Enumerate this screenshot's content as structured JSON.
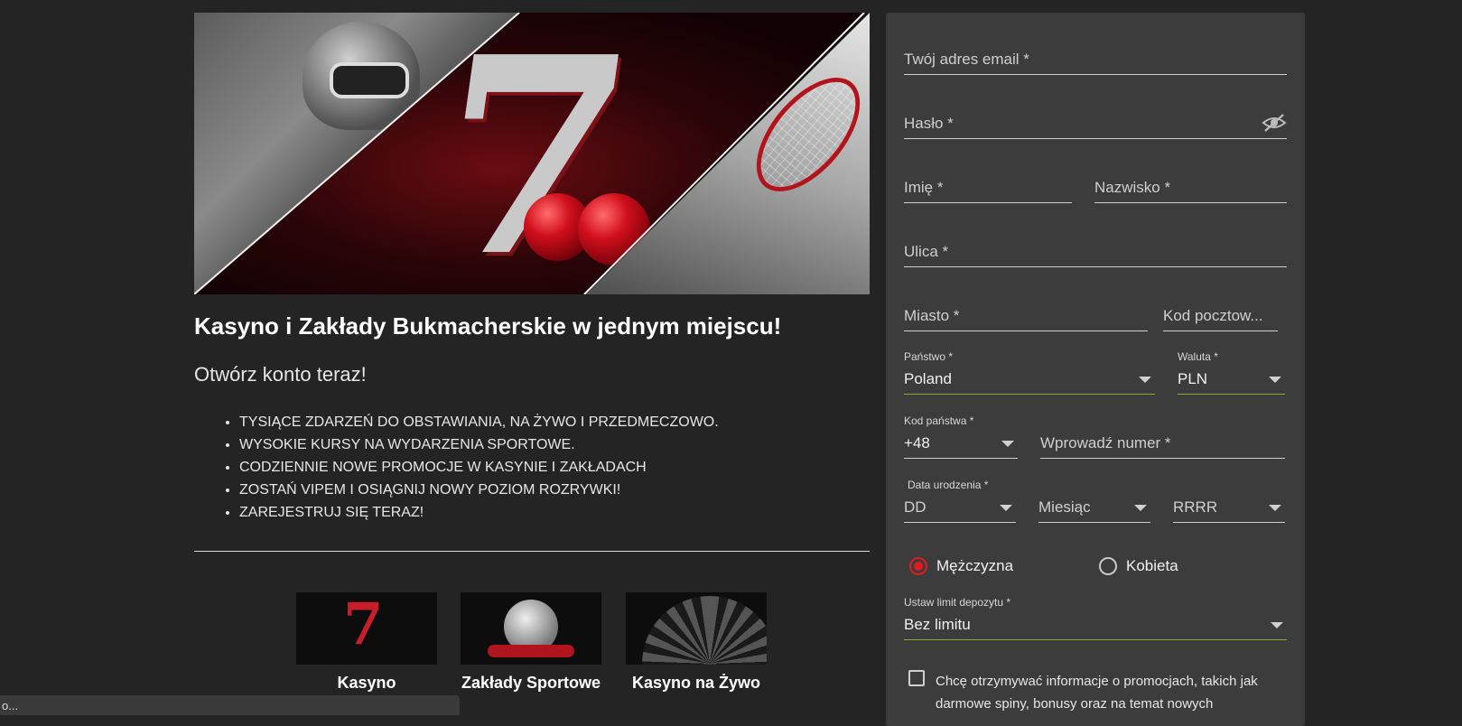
{
  "hero": {
    "alt": "kasyno i sport"
  },
  "headline": "Kasyno i Zakłady Bukmacherskie w jednym miejscu!",
  "subhead": "Otwórz konto teraz!",
  "features": [
    "TYSIĄCE ZDARZEŃ DO OBSTAWIANIA, NA ŻYWO I PRZEDMECZOWO.",
    "WYSOKIE KURSY NA WYDARZENIA SPORTOWE.",
    "CODZIENNIE NOWE PROMOCJE W KASYNIE I ZAKŁADACH",
    "ZOSTAŃ VIPEM I OSIĄGNIJ NOWY POZIOM ROZRYWKI!",
    "ZAREJESTRUJ SIĘ TERAZ!"
  ],
  "tiles": [
    {
      "label": "Kasyno"
    },
    {
      "label": "Zakłady Sportowe"
    },
    {
      "label": "Kasyno na Żywo"
    }
  ],
  "statusbar": "o...",
  "form": {
    "email_placeholder": "Twój adres email *",
    "password_placeholder": "Hasło *",
    "firstname_placeholder": "Imię *",
    "lastname_placeholder": "Nazwisko *",
    "street_placeholder": "Ulica *",
    "city_placeholder": "Miasto *",
    "postcode_placeholder": "Kod pocztow...",
    "country_label": "Państwo *",
    "country_value": "Poland",
    "currency_label": "Waluta *",
    "currency_value": "PLN",
    "phone_code_label": "Kod państwa *",
    "phone_code_value": "+48",
    "phone_placeholder": "Wprowadź numer *",
    "dob_label": "Data urodzenia *",
    "dob_day": "DD",
    "dob_month": "Miesiąc",
    "dob_year": "RRRR",
    "gender_male": "Mężczyzna",
    "gender_female": "Kobieta",
    "gender_selected": "male",
    "deposit_label": "Ustaw limit depozytu *",
    "deposit_value": "Bez limitu",
    "promo_text": "Chcę otrzymywać informacje o promocjach, takich jak darmowe spiny, bonusy oraz na temat nowych"
  },
  "colors": {
    "accent": "#e11b22",
    "valid": "#7fae3a",
    "panel": "#3c3c3c",
    "bg": "#242424"
  }
}
